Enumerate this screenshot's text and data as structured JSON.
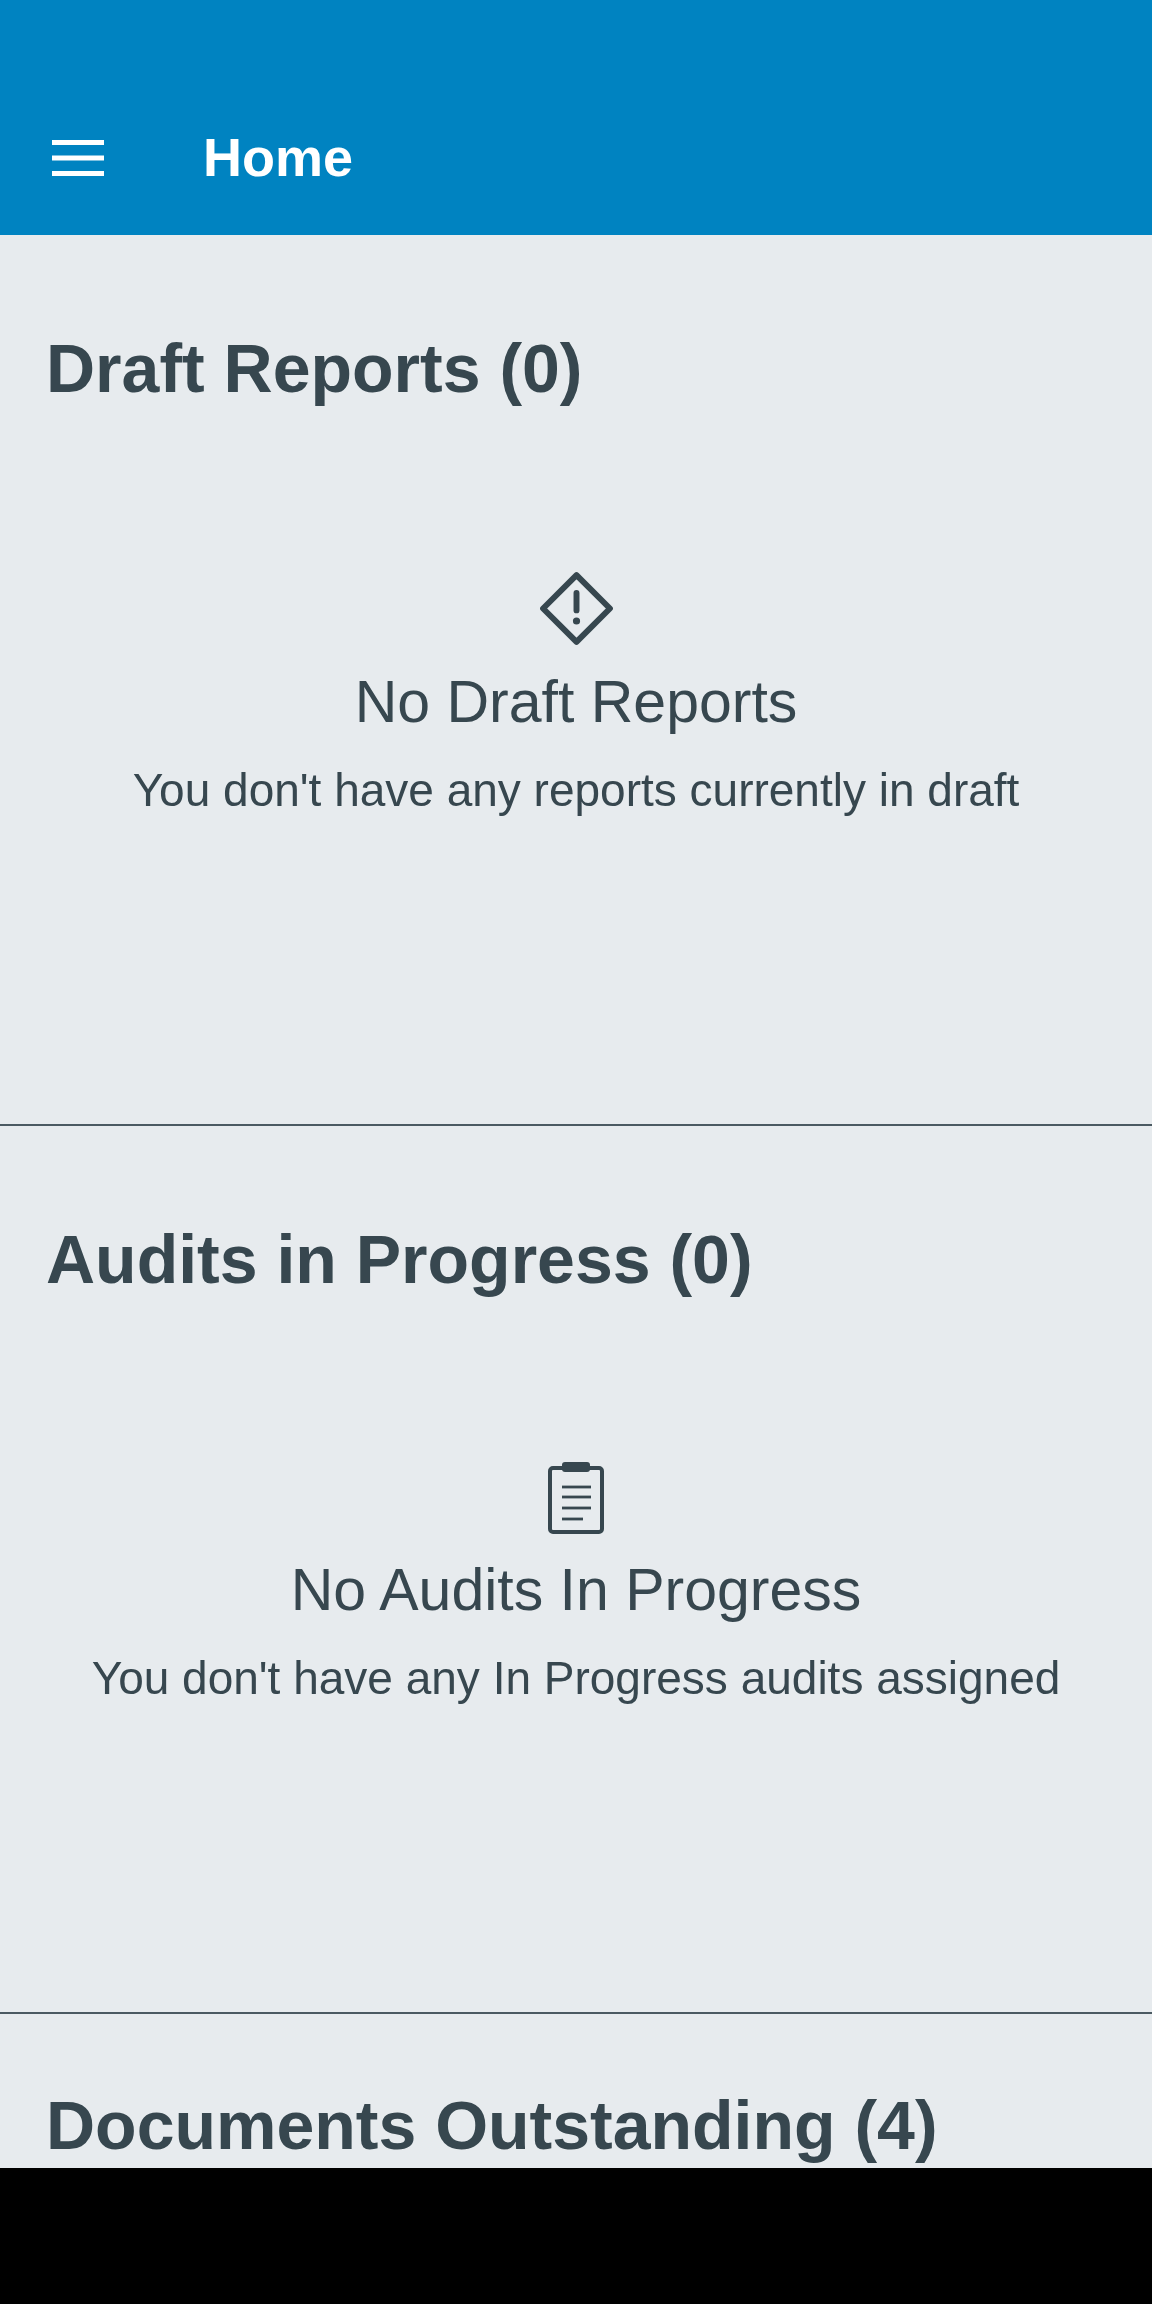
{
  "app_bar": {
    "title": "Home"
  },
  "sections": [
    {
      "heading": "Draft Reports (0)",
      "empty_state": {
        "kind": "drafts",
        "title": "No Draft Reports",
        "message": "You don't have any reports currently in draft"
      }
    },
    {
      "heading": "Audits in Progress (0)",
      "empty_state": {
        "kind": "audits",
        "title": "No Audits In Progress",
        "message": "You don't have any In Progress audits assigned"
      }
    },
    {
      "heading": "Documents Outstanding (4)"
    }
  ]
}
